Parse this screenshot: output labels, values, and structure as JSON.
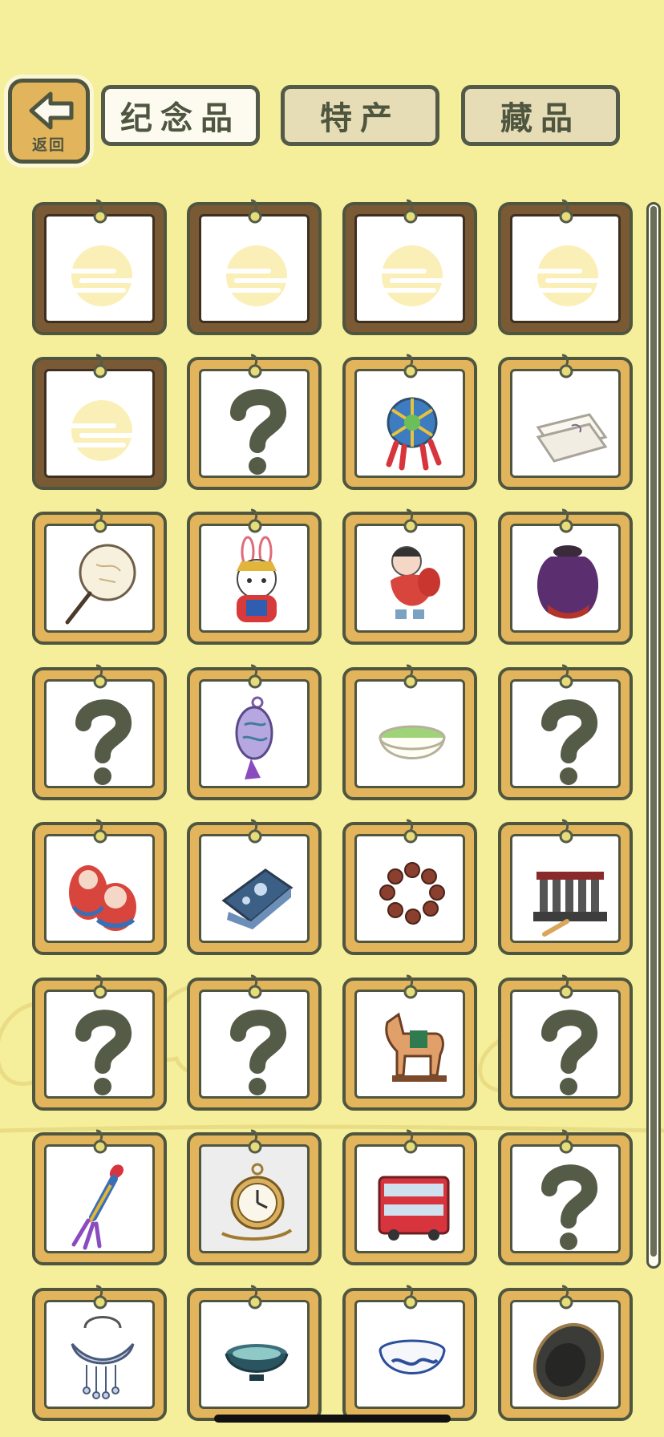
{
  "header": {
    "back_label": "返回",
    "tabs": [
      {
        "label": "纪念品",
        "active": true
      },
      {
        "label": "特产",
        "active": false
      },
      {
        "label": "藏品",
        "active": false
      }
    ]
  },
  "grid": {
    "columns": 4,
    "items": [
      {
        "icon": "locked-placeholder-icon",
        "frame": "brown"
      },
      {
        "icon": "locked-placeholder-icon",
        "frame": "brown"
      },
      {
        "icon": "locked-placeholder-icon",
        "frame": "brown"
      },
      {
        "icon": "locked-placeholder-icon",
        "frame": "brown"
      },
      {
        "icon": "locked-placeholder-icon",
        "frame": "brown"
      },
      {
        "icon": "question-mark-icon",
        "frame": "gold"
      },
      {
        "icon": "temari-ball-icon",
        "frame": "gold"
      },
      {
        "icon": "folded-cloth-icon",
        "frame": "gold"
      },
      {
        "icon": "silk-fan-icon",
        "frame": "gold"
      },
      {
        "icon": "rabbit-figurine-icon",
        "frame": "gold"
      },
      {
        "icon": "clay-doll-icon",
        "frame": "gold"
      },
      {
        "icon": "pottery-jar-icon",
        "frame": "gold"
      },
      {
        "icon": "question-mark-icon",
        "frame": "gold"
      },
      {
        "icon": "lantern-charm-icon",
        "frame": "gold"
      },
      {
        "icon": "matcha-bowl-icon",
        "frame": "gold"
      },
      {
        "icon": "question-mark-icon",
        "frame": "gold"
      },
      {
        "icon": "nesting-dolls-icon",
        "frame": "gold"
      },
      {
        "icon": "paisley-scarf-icon",
        "frame": "gold"
      },
      {
        "icon": "bead-bracelet-icon",
        "frame": "gold"
      },
      {
        "icon": "gamelan-instrument-icon",
        "frame": "gold"
      },
      {
        "icon": "question-mark-icon",
        "frame": "gold"
      },
      {
        "icon": "question-mark-icon",
        "frame": "gold"
      },
      {
        "icon": "tang-horse-icon",
        "frame": "gold"
      },
      {
        "icon": "question-mark-icon",
        "frame": "gold"
      },
      {
        "icon": "tassel-knot-icon",
        "frame": "gold"
      },
      {
        "icon": "pocket-watch-icon",
        "frame": "gold",
        "selected": true
      },
      {
        "icon": "double-decker-bus-icon",
        "frame": "gold"
      },
      {
        "icon": "question-mark-icon",
        "frame": "gold"
      },
      {
        "icon": "silver-lock-pendant-icon",
        "frame": "gold"
      },
      {
        "icon": "tea-bowl-icon",
        "frame": "gold"
      },
      {
        "icon": "porcelain-bowl-icon",
        "frame": "gold"
      },
      {
        "icon": "ink-stone-icon",
        "frame": "gold"
      }
    ]
  },
  "scrollbar": {
    "position": 0.0
  }
}
